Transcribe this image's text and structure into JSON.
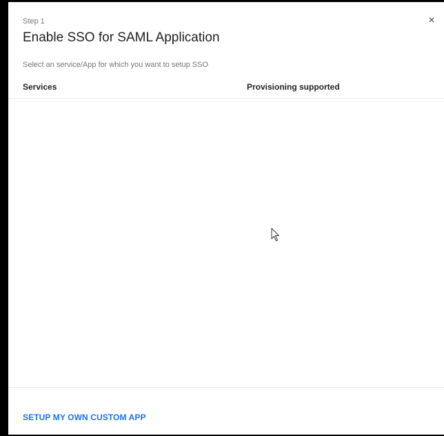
{
  "dialog": {
    "step_label": "Step 1",
    "title": "Enable SSO for SAML Application",
    "close_glyph": "×",
    "subtitle": "Select an service/App for which you want to setup SSO"
  },
  "table": {
    "columns": [
      "Services",
      "Provisioning supported"
    ],
    "rows": []
  },
  "footer": {
    "custom_app_label": "SETUP MY OWN CUSTOM APP"
  },
  "colors": {
    "link": "#1a73e8",
    "title": "#212121",
    "muted": "#757575",
    "divider": "#e8e8e8"
  },
  "icons": {
    "close": "close-icon",
    "cursor": "mouse-pointer-icon"
  }
}
